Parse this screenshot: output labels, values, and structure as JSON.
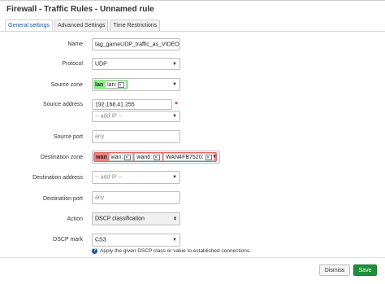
{
  "page": {
    "title": "Firewall - Traffic Rules - Unnamed rule"
  },
  "tabs": [
    {
      "label": "General settings",
      "active": true
    },
    {
      "label": "Advanced Settings",
      "active": false
    },
    {
      "label": "Time Restrictions",
      "active": false
    }
  ],
  "form": {
    "name": {
      "label": "Name",
      "value": "tag_gameUDP_traffic_as_VIDEO"
    },
    "protocol": {
      "label": "Protocol",
      "value": "UDP"
    },
    "source_zone": {
      "label": "Source zone",
      "zone": "lan",
      "chips": [
        "lan:"
      ],
      "color": "#90ee90"
    },
    "source_address": {
      "label": "Source address",
      "value": "192.168.41.255",
      "add_ip": "-- add IP --"
    },
    "source_port": {
      "label": "Source port",
      "placeholder": "any"
    },
    "destination_zone": {
      "label": "Destination zone",
      "zone": "wan",
      "chips": [
        "wan:",
        "wan6:",
        "WAN4FB7520:"
      ],
      "color": "#f08080"
    },
    "destination_address": {
      "label": "Destination address",
      "add_ip": "-- add IP --"
    },
    "destination_port": {
      "label": "Destination port",
      "placeholder": "any"
    },
    "action": {
      "label": "Action",
      "value": "DSCP classification"
    },
    "dscp_mark": {
      "label": "DSCP mark",
      "value": "CS3",
      "help": "Apply the given DSCP class or value to established connections."
    }
  },
  "footer": {
    "dismiss": "Dismiss",
    "save": "Save"
  },
  "colors": {
    "accent": "#1a56a8",
    "save": "#1f8f3a",
    "error": "#cc0000"
  }
}
